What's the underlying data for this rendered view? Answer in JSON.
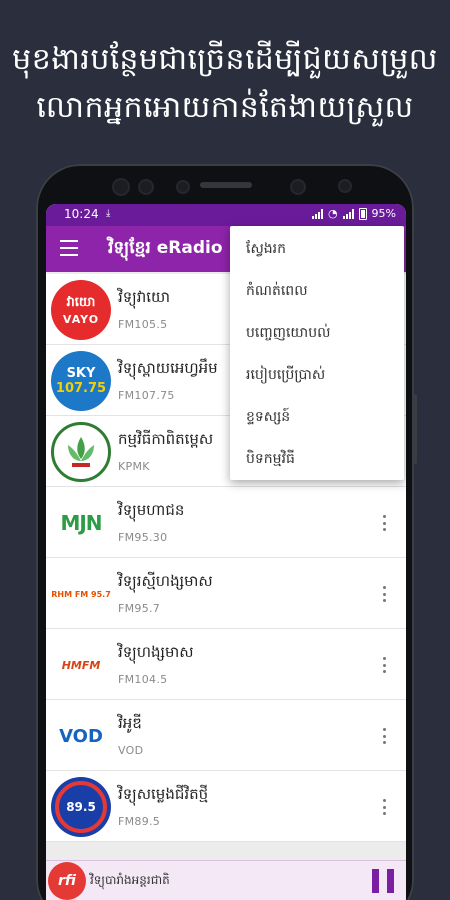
{
  "promo": {
    "line1": "មុខងារបន្ថែមជាច្រើនដើម្បីជួយសម្រួល",
    "line2": "លោកអ្នកអោយកាន់តែងាយស្រួល"
  },
  "statusbar": {
    "time": "10:24",
    "battery": "95%"
  },
  "appbar": {
    "title": "វិទ្យុខ្មែរ eRadio"
  },
  "stations": [
    {
      "name": "វិទ្យុវាយោ",
      "freq": "FM105.5",
      "logo_text_top": "វាយោ",
      "logo_text_bottom": "VAYO"
    },
    {
      "name": "វិទ្យុស្ពាយអេហ្វអឹម",
      "freq": "FM107.75",
      "logo_text_top": "SKY",
      "logo_text_bottom": "107.75"
    },
    {
      "name": "កម្មវិធីកាពិតម្ពេស",
      "freq": "KPMK"
    },
    {
      "name": "វិទ្យុមហាជន",
      "freq": "FM95.30",
      "logo_text": "MJN"
    },
    {
      "name": "វិទ្យុរស្មីហង្សមាស",
      "freq": "FM95.7",
      "logo_text": "RHM FM 95.7"
    },
    {
      "name": "វិទ្យុហង្សមាស",
      "freq": "FM104.5",
      "logo_text": "HMFM"
    },
    {
      "name": "វិអូឌី",
      "freq": "VOD",
      "logo_text": "VOD"
    },
    {
      "name": "វិទ្យុសម្លេងជីវិតថ្មី",
      "freq": "FM89.5",
      "logo_text": "89.5"
    }
  ],
  "menu": {
    "items": [
      "ស្វែងរក",
      "កំណត់ពេល",
      "បញ្ចេញយោបល់",
      "របៀបប្រើប្រាស់",
      "ខ្ទទស្សន៍",
      "បិទកម្មវិធី"
    ]
  },
  "player": {
    "logo_text": "rfi",
    "title": "វិទ្យុបារាំងអន្តរជាតិ"
  },
  "colors": {
    "appbar": "#8e24aa",
    "statusbar": "#6a1b9a",
    "background": "#2a2e3d",
    "pause": "#7b1fa2"
  }
}
